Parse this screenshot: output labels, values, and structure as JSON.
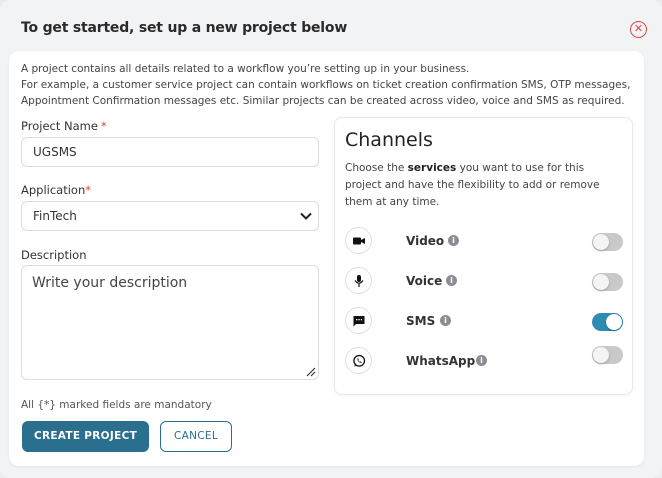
{
  "header": {
    "title": "To get started, set up a new project below",
    "close_icon": "close-circle-icon"
  },
  "intro": {
    "line1": "A project contains all details related to a workflow you’re setting up in your business.",
    "line2": "For example, a customer service project can contain workflows on ticket creation confirmation SMS, OTP messages,",
    "line3": "Appointment Confirmation messages etc. Similar projects can be created across video, voice and SMS as required."
  },
  "form": {
    "project_name_label": "Project Name",
    "project_name_value": "UGSMS",
    "application_label": "Application",
    "application_value": "FinTech",
    "description_label": "Description",
    "description_placeholder": "Write your description",
    "required_marker": "*",
    "mandatory_note": "All {*} marked fields are mandatory"
  },
  "buttons": {
    "create": "CREATE PROJECT",
    "cancel": "CANCEL"
  },
  "channels": {
    "title": "Channels",
    "desc_prefix": "Choose the ",
    "desc_bold": "services",
    "desc_suffix": " you want to use for this project and have the flexibility to add or remove them at any time.",
    "items": [
      {
        "name": "Video",
        "icon": "video-camera-icon",
        "enabled": false
      },
      {
        "name": "Voice",
        "icon": "microphone-icon",
        "enabled": false
      },
      {
        "name": "SMS",
        "icon": "chat-message-icon",
        "enabled": true
      },
      {
        "name": "WhatsApp",
        "icon": "whatsapp-icon",
        "enabled": false
      }
    ]
  },
  "colors": {
    "primary": "#2b6f8e",
    "toggle_on": "#2f8bb4",
    "required": "#e03c3c"
  }
}
